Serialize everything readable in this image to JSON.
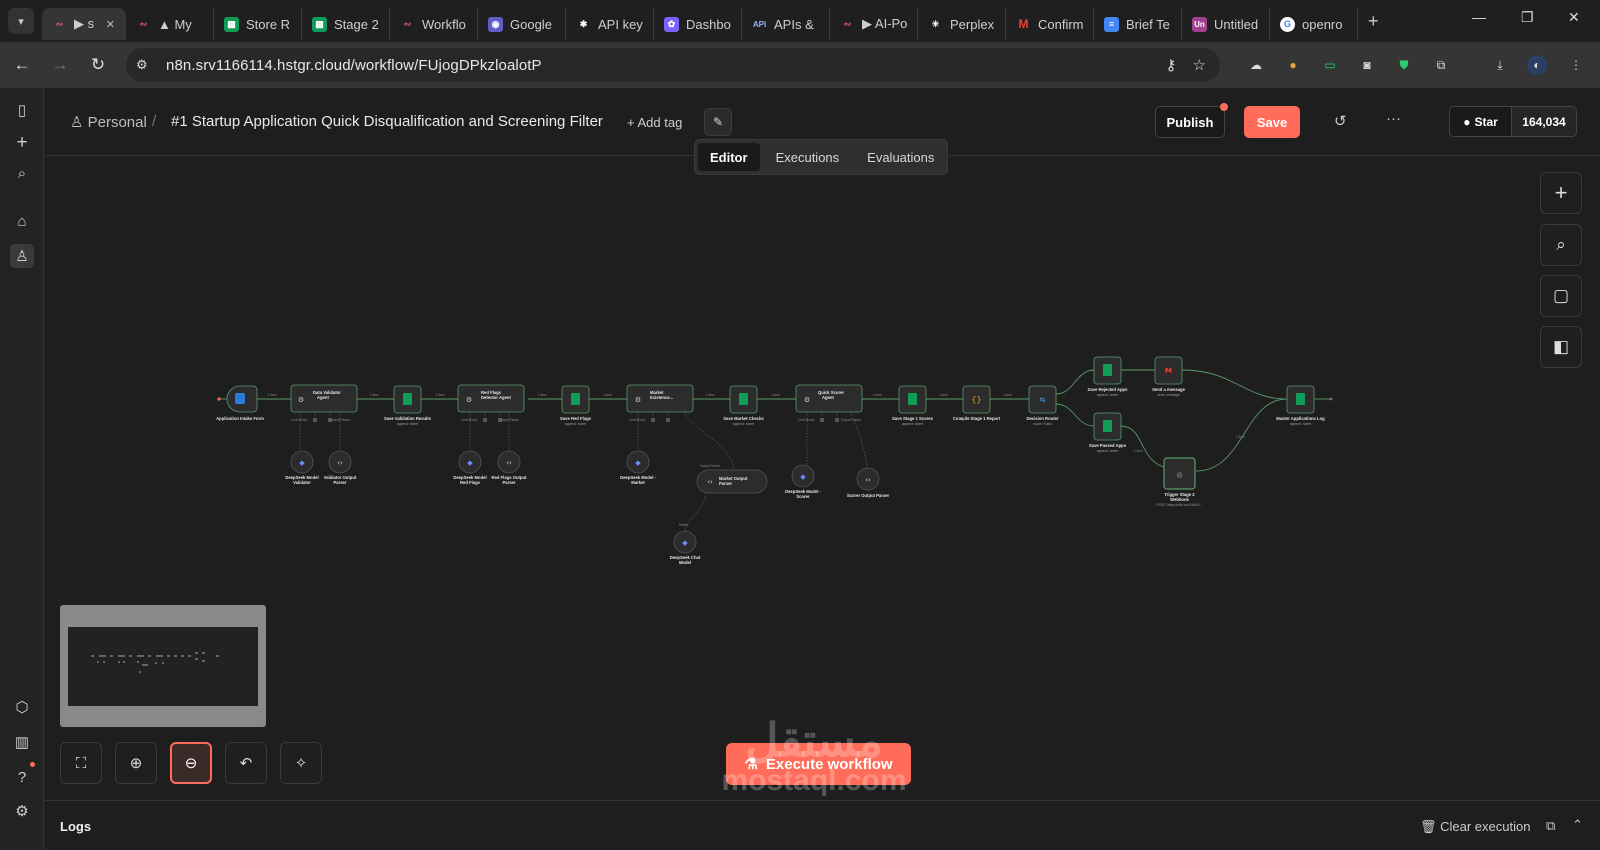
{
  "browser": {
    "tabs": [
      {
        "label": "▶ s",
        "active": true
      },
      {
        "label": "▲ My"
      },
      {
        "label": "Store R"
      },
      {
        "label": "Stage 2"
      },
      {
        "label": "Workflo"
      },
      {
        "label": "Google"
      },
      {
        "label": "API key"
      },
      {
        "label": "Dashbo"
      },
      {
        "label": "APIs &"
      },
      {
        "label": "▶ AI-Po"
      },
      {
        "label": "Perplex"
      },
      {
        "label": "Confirm"
      },
      {
        "label": "Brief Te"
      },
      {
        "label": "Untitled"
      },
      {
        "label": "openro"
      }
    ],
    "url": "n8n.srv1166114.hstgr.cloud/workflow/FUjogDPkzloalotP"
  },
  "header": {
    "owner": "Personal",
    "separator": "/",
    "title": "#1 Startup Application Quick Disqualification and Screening Filter",
    "add_tag": "+ Add tag",
    "publish": "Publish",
    "save": "Save",
    "github_star": "Star",
    "github_count": "164,034"
  },
  "view_tabs": [
    {
      "label": "Editor",
      "selected": true
    },
    {
      "label": "Executions"
    },
    {
      "label": "Evaluations"
    }
  ],
  "workflow": {
    "nodes": {
      "intake": {
        "label": "Application Intake Form"
      },
      "validator": {
        "label1": "Data Validator",
        "label2": "Agent"
      },
      "save_validation": {
        "label": "Save Validation Results",
        "sub": "append: sheet"
      },
      "redflags": {
        "label1": "Red Flags",
        "label2": "Detector Agent"
      },
      "save_redflags": {
        "label": "Save Red Flags",
        "sub": "append: sheet"
      },
      "market": {
        "label1": "Market",
        "label2": "Existence..."
      },
      "save_market": {
        "label": "Save Market Checks",
        "sub": "append: sheet"
      },
      "scorer": {
        "label1": "Quick Scorer",
        "label2": "Agent"
      },
      "save_scores": {
        "label": "Save Stage 1 Scores",
        "sub": "append: sheet"
      },
      "compile": {
        "label": "Compile Stage 1 Report"
      },
      "router": {
        "label": "Decision Router",
        "sub": "mode: Rules"
      },
      "save_rejected": {
        "label": "Save Rejected Apps",
        "sub": "append: sheet"
      },
      "send_message": {
        "label": "Send a message",
        "sub": "send: message"
      },
      "save_passed": {
        "label": "Save Passed Apps",
        "sub": "append: sheet"
      },
      "trigger": {
        "label1": "Trigger Stage 2",
        "label2": "Webhook",
        "sub": "POST: https://n8n.srv116614..."
      },
      "master": {
        "label": "Master Applications Log",
        "sub": "append: sheet"
      },
      "ds_validator": {
        "label1": "DeepSeek Model",
        "label2": "Validator"
      },
      "validator_parser": {
        "label1": "Validator Output",
        "label2": "Parser"
      },
      "ds_redflags": {
        "label1": "DeepSeek Model",
        "label2": "Red Flags"
      },
      "redflags_parser": {
        "label1": "Red Flags Output",
        "label2": "Parser"
      },
      "ds_market": {
        "label1": "DeepSeek Model -",
        "label2": "Market"
      },
      "market_parser": {
        "label1": "Market Output",
        "label2": "Parser"
      },
      "ds_chat": {
        "label1": "DeepSeek Chat",
        "label2": "Model"
      },
      "ds_scorer": {
        "label1": "DeepSeek Model -",
        "label2": "Scorer"
      },
      "scorer_parser": {
        "label": "Scorer Output Parser"
      }
    },
    "connection_labels": {
      "item": "1 item",
      "model": "Chat Model",
      "parser": "Output Parser",
      "memory": "Memory",
      "tool": "Tool",
      "model_sub": "Model"
    }
  },
  "bottom": {
    "execute": "Execute workflow",
    "logs": "Logs",
    "clear_execution": "Clear execution"
  },
  "watermark": {
    "arabic": "مستقل",
    "latin": "mostaql.com"
  },
  "colors": {
    "accent": "#ff6d5a",
    "sheets_green": "#0f9d58",
    "connection_green": "#4a8a5a",
    "node_bg": "#2c2c2c"
  }
}
